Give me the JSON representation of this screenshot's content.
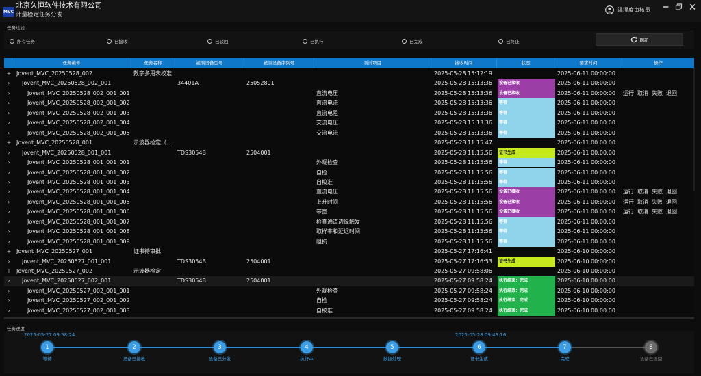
{
  "app": {
    "logo_text": "MVC",
    "title": "北京久恒软件技术有限公司",
    "subtitle": "计量检定任务分发",
    "user": "温湿度审核员"
  },
  "filter": {
    "label": "任务过滤",
    "options": [
      "所有任务",
      "已接收",
      "已驳回",
      "已执行",
      "已完成",
      "已终止"
    ],
    "refresh_label": "刷新"
  },
  "table": {
    "columns": [
      "任务编号",
      "任务名称",
      "被测设备型号",
      "被测设备序列号",
      "测试项目",
      "接收时间",
      "状态",
      "要求时间",
      "操作"
    ],
    "action_labels": [
      "运行",
      "取消",
      "失败",
      "退回"
    ],
    "rows": [
      {
        "exp": "+",
        "level": 0,
        "id": "Jovent_MVC_20250528_002",
        "name": "数字多用表校准",
        "model": "",
        "serial": "",
        "item": "",
        "recv": "2025-05-28 15:12:19",
        "status": "",
        "req": "2025-06-11 00:00:00",
        "ops": false
      },
      {
        "exp": "›",
        "level": 1,
        "id": "Jovent_MVC_20250528_002_001",
        "name": "",
        "model": "34401A",
        "serial": "25052801",
        "item": "",
        "recv": "2025-05-28 15:13:36",
        "status": "设备已接收",
        "req": "2025-06-11 00:00:00",
        "ops": false
      },
      {
        "exp": "›",
        "level": 2,
        "id": "Jovent_MVC_20250528_002_001_001",
        "name": "",
        "model": "",
        "serial": "",
        "item": "直流电压",
        "recv": "2025-05-28 15:13:36",
        "status": "设备已接收",
        "req": "2025-06-11 00:00:00",
        "ops": true
      },
      {
        "exp": "›",
        "level": 2,
        "id": "Jovent_MVC_20250528_002_001_002",
        "name": "",
        "model": "",
        "serial": "",
        "item": "直流电流",
        "recv": "2025-05-28 15:13:36",
        "status": "等待",
        "req": "2025-06-11 00:00:00",
        "ops": false
      },
      {
        "exp": "›",
        "level": 2,
        "id": "Jovent_MVC_20250528_002_001_003",
        "name": "",
        "model": "",
        "serial": "",
        "item": "直流电阻",
        "recv": "2025-05-28 15:13:36",
        "status": "等待",
        "req": "2025-06-11 00:00:00",
        "ops": false
      },
      {
        "exp": "›",
        "level": 2,
        "id": "Jovent_MVC_20250528_002_001_004",
        "name": "",
        "model": "",
        "serial": "",
        "item": "交流电压",
        "recv": "2025-05-28 15:13:36",
        "status": "等待",
        "req": "2025-06-11 00:00:00",
        "ops": false
      },
      {
        "exp": "›",
        "level": 2,
        "id": "Jovent_MVC_20250528_002_001_005",
        "name": "",
        "model": "",
        "serial": "",
        "item": "交流电流",
        "recv": "2025-05-28 15:13:36",
        "status": "等待",
        "req": "2025-06-11 00:00:00",
        "ops": false
      },
      {
        "exp": "+",
        "level": 0,
        "id": "Jovent_MVC_20250528_001",
        "name": "示波器检定（...",
        "model": "",
        "serial": "",
        "item": "",
        "recv": "2025-05-28 11:15:47",
        "status": "",
        "req": "2025-06-11 00:00:00",
        "ops": false
      },
      {
        "exp": "›",
        "level": 1,
        "id": "Jovent_MVC_20250528_001_001",
        "name": "",
        "model": "TDS3054B",
        "serial": "2504001",
        "item": "",
        "recv": "2025-05-28 11:15:56",
        "status": "证书生成",
        "req": "2025-06-11 00:00:00",
        "ops": false
      },
      {
        "exp": "›",
        "level": 2,
        "id": "Jovent_MVC_20250528_001_001_001",
        "name": "",
        "model": "",
        "serial": "",
        "item": "外观检查",
        "recv": "2025-05-28 11:15:56",
        "status": "等待",
        "req": "2025-06-11 00:00:00",
        "ops": false
      },
      {
        "exp": "›",
        "level": 2,
        "id": "Jovent_MVC_20250528_001_001_002",
        "name": "",
        "model": "",
        "serial": "",
        "item": "自检",
        "recv": "2025-05-28 11:15:56",
        "status": "等待",
        "req": "2025-06-11 00:00:00",
        "ops": false
      },
      {
        "exp": "›",
        "level": 2,
        "id": "Jovent_MVC_20250528_001_001_003",
        "name": "",
        "model": "",
        "serial": "",
        "item": "自校准",
        "recv": "2025-05-28 11:15:56",
        "status": "等待",
        "req": "2025-06-11 00:00:00",
        "ops": false
      },
      {
        "exp": "›",
        "level": 2,
        "id": "Jovent_MVC_20250528_001_001_004",
        "name": "",
        "model": "",
        "serial": "",
        "item": "直流电压",
        "recv": "2025-05-28 11:15:56",
        "status": "设备已接收",
        "req": "2025-06-11 00:00:00",
        "ops": true
      },
      {
        "exp": "›",
        "level": 2,
        "id": "Jovent_MVC_20250528_001_001_005",
        "name": "",
        "model": "",
        "serial": "",
        "item": "上升时间",
        "recv": "2025-05-28 11:15:56",
        "status": "设备已接收",
        "req": "2025-06-11 00:00:00",
        "ops": true
      },
      {
        "exp": "›",
        "level": 2,
        "id": "Jovent_MVC_20250528_001_001_006",
        "name": "",
        "model": "",
        "serial": "",
        "item": "带宽",
        "recv": "2025-05-28 11:15:56",
        "status": "设备已接收",
        "req": "2025-06-11 00:00:00",
        "ops": true
      },
      {
        "exp": "›",
        "level": 2,
        "id": "Jovent_MVC_20250528_001_001_007",
        "name": "",
        "model": "",
        "serial": "",
        "item": "检查通道边缘触发",
        "recv": "2025-05-28 11:15:56",
        "status": "等待",
        "req": "2025-06-11 00:00:00",
        "ops": false
      },
      {
        "exp": "›",
        "level": 2,
        "id": "Jovent_MVC_20250528_001_001_008",
        "name": "",
        "model": "",
        "serial": "",
        "item": "取样率和延迟时间",
        "recv": "2025-05-28 11:15:56",
        "status": "等待",
        "req": "2025-06-11 00:00:00",
        "ops": false
      },
      {
        "exp": "›",
        "level": 2,
        "id": "Jovent_MVC_20250528_001_001_009",
        "name": "",
        "model": "",
        "serial": "",
        "item": "阻抗",
        "recv": "2025-05-28 11:15:56",
        "status": "等待",
        "req": "2025-06-11 00:00:00",
        "ops": false
      },
      {
        "exp": "+",
        "level": 0,
        "id": "Jovent_MVC_20250527_001",
        "name": "证书待审批",
        "model": "",
        "serial": "",
        "item": "",
        "recv": "2025-05-27 17:16:41",
        "status": "",
        "req": "2025-06-10 00:00:00",
        "ops": false
      },
      {
        "exp": "›",
        "level": 1,
        "id": "Jovent_MVC_20250527_001_001",
        "name": "",
        "model": "TDS3054B",
        "serial": "2504001",
        "item": "",
        "recv": "2025-05-27 17:16:53",
        "status": "证书生成",
        "req": "2025-06-10 00:00:00",
        "ops": false
      },
      {
        "exp": "+",
        "level": 0,
        "id": "Jovent_MVC_20250527_002",
        "name": "示波器检定",
        "model": "",
        "serial": "",
        "item": "",
        "recv": "2025-05-27 09:58:06",
        "status": "",
        "req": "2025-06-10 00:00:00",
        "ops": false
      },
      {
        "exp": "›",
        "level": 1,
        "id": "Jovent_MVC_20250527_002_001",
        "name": "",
        "model": "TDS3054B",
        "serial": "2504001",
        "item": "",
        "recv": "2025-05-27 09:58:24",
        "status": "执行结束：完成",
        "req": "2025-06-10 00:00:00",
        "ops": false,
        "selected": true
      },
      {
        "exp": "›",
        "level": 2,
        "id": "Jovent_MVC_20250527_002_001_001",
        "name": "",
        "model": "",
        "serial": "",
        "item": "外观检查",
        "recv": "2025-05-27 09:58:24",
        "status": "执行结束：完成",
        "req": "2025-06-10 00:00:00",
        "ops": false
      },
      {
        "exp": "›",
        "level": 2,
        "id": "Jovent_MVC_20250527_002_001_002",
        "name": "",
        "model": "",
        "serial": "",
        "item": "自检",
        "recv": "2025-05-27 09:58:24",
        "status": "执行结束：完成",
        "req": "2025-06-10 00:00:00",
        "ops": false
      },
      {
        "exp": "›",
        "level": 2,
        "id": "Jovent_MVC_20250527_002_001_003",
        "name": "",
        "model": "",
        "serial": "",
        "item": "自校准",
        "recv": "2025-05-27 09:58:24",
        "status": "执行结束：完成",
        "req": "2025-06-10 00:00:00",
        "ops": false
      }
    ]
  },
  "status_colors": {
    "设备已接收": "#9b3fa6",
    "等待": "#8fd4ea",
    "证书生成": "#c6ea1c",
    "执行结束：完成": "#22b24c"
  },
  "status_text_colors": {
    "设备已接收": "#ffffff",
    "等待": "#ffffff",
    "证书生成": "#111111",
    "执行结束：完成": "#ffffff"
  },
  "progress": {
    "label": "任务进度",
    "date_start": "2025-05-27 09:58:24",
    "date_mid": "2025-05-28 09:43:16",
    "steps": [
      {
        "num": "1",
        "label": "等待",
        "done": true
      },
      {
        "num": "2",
        "label": "设备已接收",
        "done": true
      },
      {
        "num": "3",
        "label": "设备已分发",
        "done": true
      },
      {
        "num": "4",
        "label": "执行中",
        "done": true
      },
      {
        "num": "5",
        "label": "数据处理",
        "done": true
      },
      {
        "num": "6",
        "label": "证书生成",
        "done": true
      },
      {
        "num": "7",
        "label": "完成",
        "done": true
      },
      {
        "num": "8",
        "label": "设备已退回",
        "done": false
      }
    ]
  },
  "icons": {
    "user": "user-circle-icon",
    "refresh": "refresh-icon",
    "minimize": "minimize-icon",
    "restore": "restore-icon",
    "close": "close-icon"
  }
}
